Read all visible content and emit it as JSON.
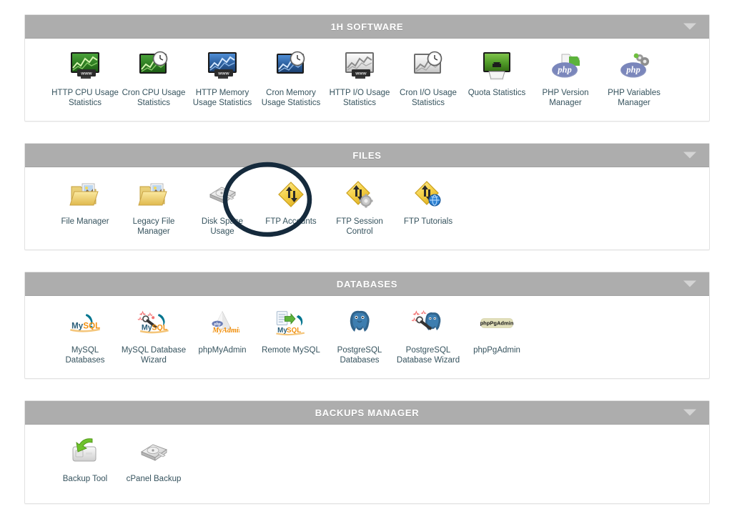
{
  "page": {
    "background_color": "#ffffff",
    "label_color": "#36535e",
    "header_bg_color": "#adadad",
    "header_text_color": "#ffffff",
    "annotation_color": "#152a3c"
  },
  "annotation": {
    "shape": "ellipse",
    "target": "FTP Accounts",
    "color": "#152a3c",
    "stroke_width": 6
  },
  "sections": [
    {
      "id": "1h-software",
      "title": "1H SOFTWARE",
      "collapse_icon": "chevron-down-icon",
      "items": [
        {
          "label": "HTTP CPU Usage Statistics",
          "icon": "green-monitor-chart-www-icon"
        },
        {
          "label": "Cron CPU Usage Statistics",
          "icon": "green-monitor-chart-clock-icon"
        },
        {
          "label": "HTTP Memory Usage Statistics",
          "icon": "blue-monitor-chart-www-icon"
        },
        {
          "label": "Cron Memory Usage Statistics",
          "icon": "blue-monitor-chart-clock-icon"
        },
        {
          "label": "HTTP I/O Usage Statistics",
          "icon": "gray-monitor-chart-www-icon"
        },
        {
          "label": "Cron I/O Usage Statistics",
          "icon": "gray-monitor-chart-clock-icon"
        },
        {
          "label": "Quota Statistics",
          "icon": "green-monitor-download-icon"
        },
        {
          "label": "PHP Version Manager",
          "icon": "php-folder-icon"
        },
        {
          "label": "PHP Variables Manager",
          "icon": "php-gear-icon"
        }
      ]
    },
    {
      "id": "files",
      "title": "FILES",
      "collapse_icon": "chevron-down-icon",
      "items": [
        {
          "label": "File Manager",
          "icon": "yellow-folder-image-icon"
        },
        {
          "label": "Legacy File Manager",
          "icon": "yellow-folder-image-icon"
        },
        {
          "label": "Disk Space Usage",
          "icon": "hard-disk-icon"
        },
        {
          "label": "FTP Accounts",
          "icon": "ftp-diamond-arrows-icon"
        },
        {
          "label": "FTP Session Control",
          "icon": "ftp-diamond-gear-icon"
        },
        {
          "label": "FTP Tutorials",
          "icon": "ftp-diamond-globe-icon"
        }
      ]
    },
    {
      "id": "databases",
      "title": "DATABASES",
      "collapse_icon": "chevron-down-icon",
      "items": [
        {
          "label": "MySQL Databases",
          "icon": "mysql-dolphin-icon"
        },
        {
          "label": "MySQL Database Wizard",
          "icon": "mysql-wizard-wand-icon"
        },
        {
          "label": "phpMyAdmin",
          "icon": "phpmyadmin-icon"
        },
        {
          "label": "Remote MySQL",
          "icon": "remote-mysql-icon"
        },
        {
          "label": "PostgreSQL Databases",
          "icon": "postgresql-elephant-icon"
        },
        {
          "label": "PostgreSQL Database Wizard",
          "icon": "postgresql-wizard-wand-icon"
        },
        {
          "label": "phpPgAdmin",
          "icon": "phppgadmin-icon"
        }
      ]
    },
    {
      "id": "backups-manager",
      "title": "BACKUPS MANAGER",
      "collapse_icon": "chevron-down-icon",
      "items": [
        {
          "label": "Backup Tool",
          "icon": "backup-restore-arrow-icon"
        },
        {
          "label": "cPanel Backup",
          "icon": "hard-disk-icon"
        }
      ]
    }
  ]
}
